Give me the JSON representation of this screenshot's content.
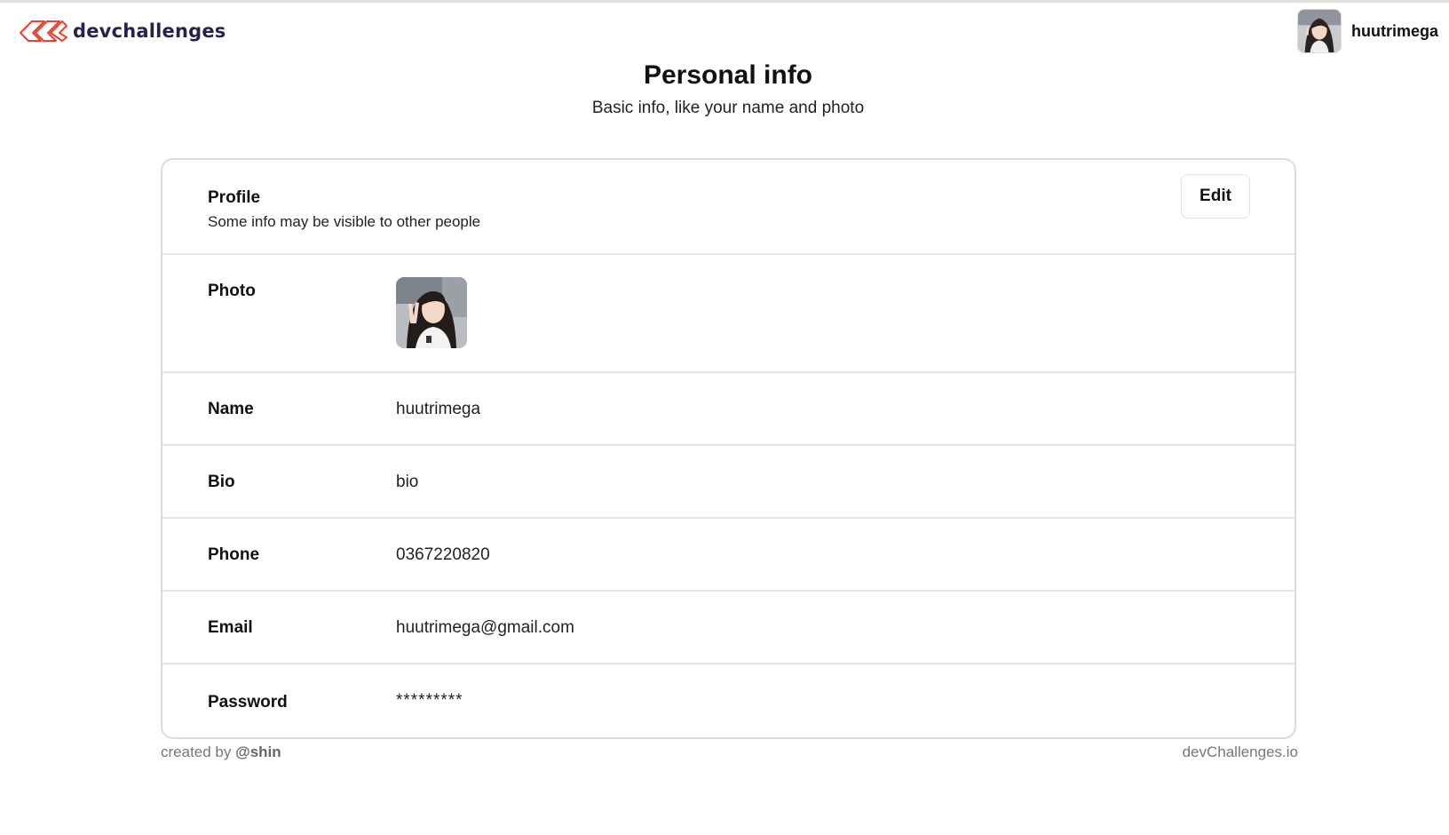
{
  "header": {
    "brand": "devchallenges",
    "logo_icon": "devchallenges-logo-icon",
    "user_name": "huutrimega"
  },
  "page": {
    "title": "Personal info",
    "subtitle": "Basic info, like your name and photo"
  },
  "card": {
    "title": "Profile",
    "subtitle": "Some info may be visible to other people",
    "edit_label": "Edit",
    "rows": [
      {
        "label": "Photo",
        "value": ""
      },
      {
        "label": "Name",
        "value": "huutrimega"
      },
      {
        "label": "Bio",
        "value": "bio"
      },
      {
        "label": "Phone",
        "value": "0367220820"
      },
      {
        "label": "Email",
        "value": "huutrimega@gmail.com"
      },
      {
        "label": "Password",
        "value": "*********"
      }
    ]
  },
  "footer": {
    "created_by_prefix": "created by",
    "author": "@shin",
    "site": "devChallenges.io"
  },
  "colors": {
    "brand_text": "#282051",
    "logo_accent": "#E5432D",
    "border": "#dcdcdc"
  }
}
